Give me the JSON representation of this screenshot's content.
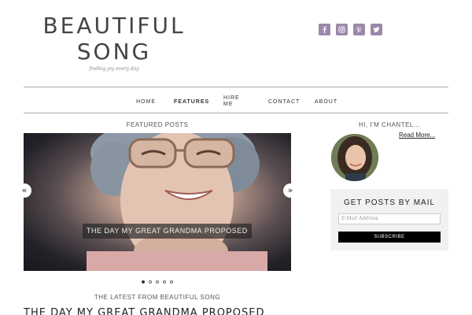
{
  "header": {
    "title_line1": "BEAUTIFUL",
    "title_line2": "SONG",
    "tagline": "finding joy every day"
  },
  "social": [
    {
      "name": "facebook-icon"
    },
    {
      "name": "instagram-icon"
    },
    {
      "name": "pinterest-icon"
    },
    {
      "name": "twitter-icon"
    }
  ],
  "nav": {
    "home": "HOME",
    "features": "FEATURES",
    "hire_line1": "HIRE",
    "hire_line2": "ME",
    "contact": "CONTACT",
    "about": "ABOUT"
  },
  "featured": {
    "label": "FEATURED POSTS",
    "caption": "THE DAY MY GREAT GRANDMA PROPOSED",
    "prev": "«",
    "next": "»",
    "slide_count": 5,
    "active_slide": 1
  },
  "latest": {
    "label": "THE LATEST FROM BEAUTIFUL SONG",
    "post_title": "THE DAY MY GREAT GRANDMA PROPOSED"
  },
  "sidebar": {
    "greeting": "HI, I'M CHANTEL...",
    "read_more": "Read More...",
    "mail_title": "GET POSTS BY MAIL",
    "email_placeholder": "E-Mail Address",
    "subscribe": "SUBSCRIBE"
  },
  "colors": {
    "social_bg": "#9b88a8",
    "nav_rule": "#aaaaaa",
    "mail_box_bg": "#f1f1f1"
  }
}
